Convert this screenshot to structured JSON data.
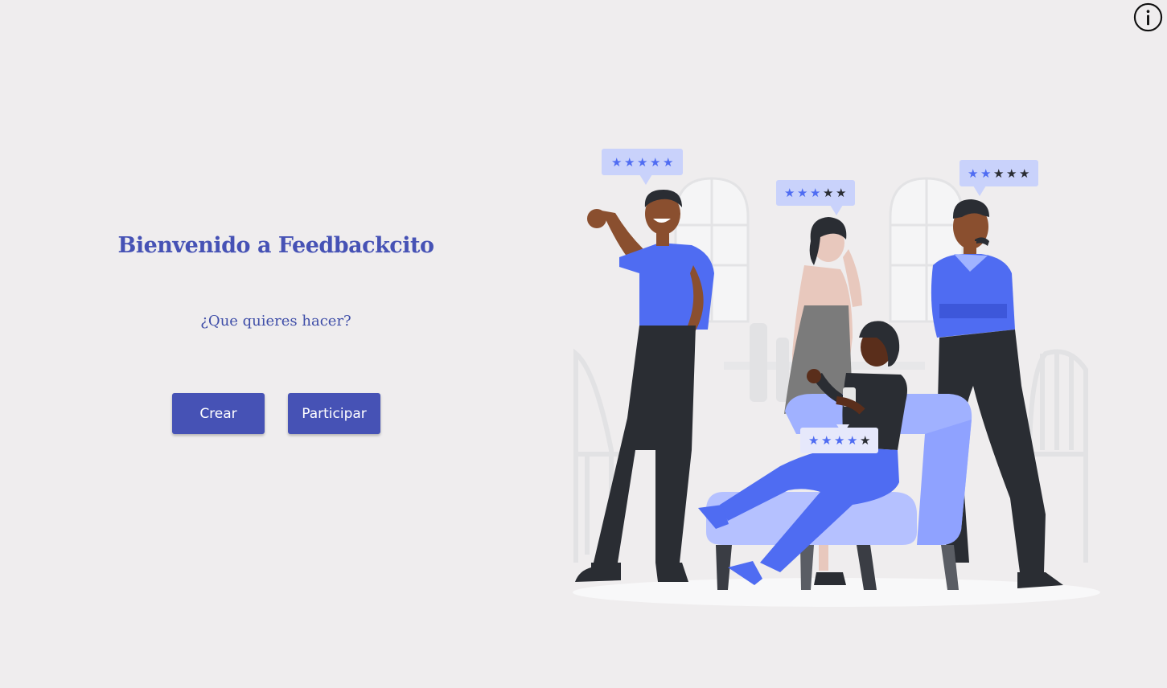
{
  "header": {
    "info_icon": "info-circle-icon"
  },
  "welcome": {
    "title": "Bienvenido a Feedbackcito",
    "subtitle": "¿Que quieres hacer?"
  },
  "actions": {
    "create_label": "Crear",
    "join_label": "Participar"
  },
  "illustration": {
    "ratings": [
      {
        "filled": 5,
        "total": 5
      },
      {
        "filled": 3,
        "total": 5
      },
      {
        "filled": 2,
        "total": 5
      },
      {
        "filled": 4,
        "total": 5
      }
    ]
  },
  "colors": {
    "background": "#efedee",
    "primary": "#4652b5",
    "accent": "#4f6cf2"
  }
}
